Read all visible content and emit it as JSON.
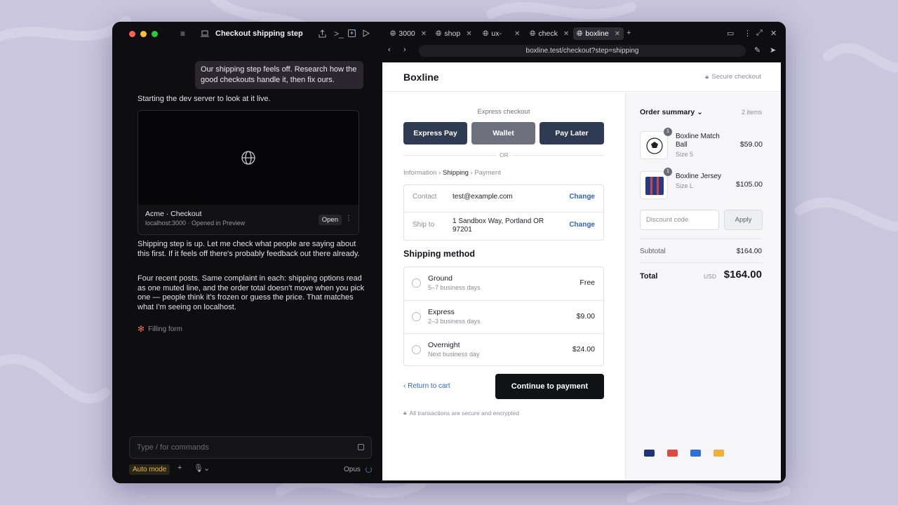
{
  "left_pane": {
    "title": "Checkout shipping step",
    "user_message": "Our shipping step feels off. Research how the good checkouts handle it, then fix ours.",
    "assistant_msg_1": "Starting the dev server to look at it live.",
    "preview": {
      "title": "Acme · Checkout",
      "subtitle": "localhost:3000 · Opened in Preview",
      "open_label": "Open",
      "more_icon": "⋮"
    },
    "assistant_msg_2": "Shipping step is up. Let me check what people are saying about this first. If it feels off there's probably feedback out there already.",
    "assistant_msg_3": "Four recent posts. Same complaint in each: shipping options read as one muted line, and the order total doesn't move when you pick one — people think it's frozen or guess the price. That matches what I'm seeing on localhost.",
    "status": "Filling form",
    "input_placeholder": "Type / for commands",
    "mode": "Auto mode",
    "model": "Opus"
  },
  "colors": {
    "traffic_red": "#ff5f57",
    "traffic_yellow": "#febc2e",
    "traffic_green": "#28c840",
    "express_pay": "#2e3b52",
    "wallet": "#6c717d",
    "pay_later": "#2e3b52",
    "link": "#2f63c6"
  },
  "browser": {
    "tabs": [
      {
        "label": "3000",
        "active": false
      },
      {
        "label": "shop",
        "active": false
      },
      {
        "label": "ux-",
        "active": false
      },
      {
        "label": "check",
        "active": false
      },
      {
        "label": "boxline",
        "active": true
      }
    ],
    "url": "boxline.test/checkout?step=shipping"
  },
  "checkout": {
    "brand": "Boxline",
    "secure_label": "Secure checkout",
    "express_label": "Express checkout",
    "express_buttons": [
      "Express Pay",
      "Wallet",
      "Pay Later"
    ],
    "or_label": "OR",
    "breadcrumb": {
      "step1": "Information",
      "step2": "Shipping",
      "step3": "Payment",
      "sep": "›"
    },
    "contact": {
      "label": "Contact",
      "value": "test@example.com",
      "action": "Change"
    },
    "ship_to": {
      "label": "Ship to",
      "value": "1 Sandbox Way, Portland OR 97201",
      "action": "Change"
    },
    "shipping_title": "Shipping method",
    "shipping_options": [
      {
        "name": "Ground",
        "eta": "5–7 business days",
        "price": "Free"
      },
      {
        "name": "Express",
        "eta": "2–3 business days",
        "price": "$9.00"
      },
      {
        "name": "Overnight",
        "eta": "Next business day",
        "price": "$24.00"
      }
    ],
    "return_label": "Return to cart",
    "continue_label": "Continue to payment",
    "encrypted_note": "All transactions are secure and encrypted"
  },
  "summary": {
    "title": "Order summary",
    "count": "2 items",
    "items": [
      {
        "name": "Boxline Match Ball",
        "variant": "Size 5",
        "price": "$59.00",
        "qty": "1"
      },
      {
        "name": "Boxline Jersey",
        "variant": "Size L",
        "price": "$105.00",
        "qty": "1"
      }
    ],
    "discount_placeholder": "Discount code",
    "apply_label": "Apply",
    "subtotal_label": "Subtotal",
    "subtotal_value": "$164.00",
    "total_label": "Total",
    "total_currency": "USD",
    "total_value": "$164.00",
    "payment_swatches": [
      "#1f3478",
      "#e04a3f",
      "#2f6fd6",
      "#f0b13a"
    ]
  }
}
